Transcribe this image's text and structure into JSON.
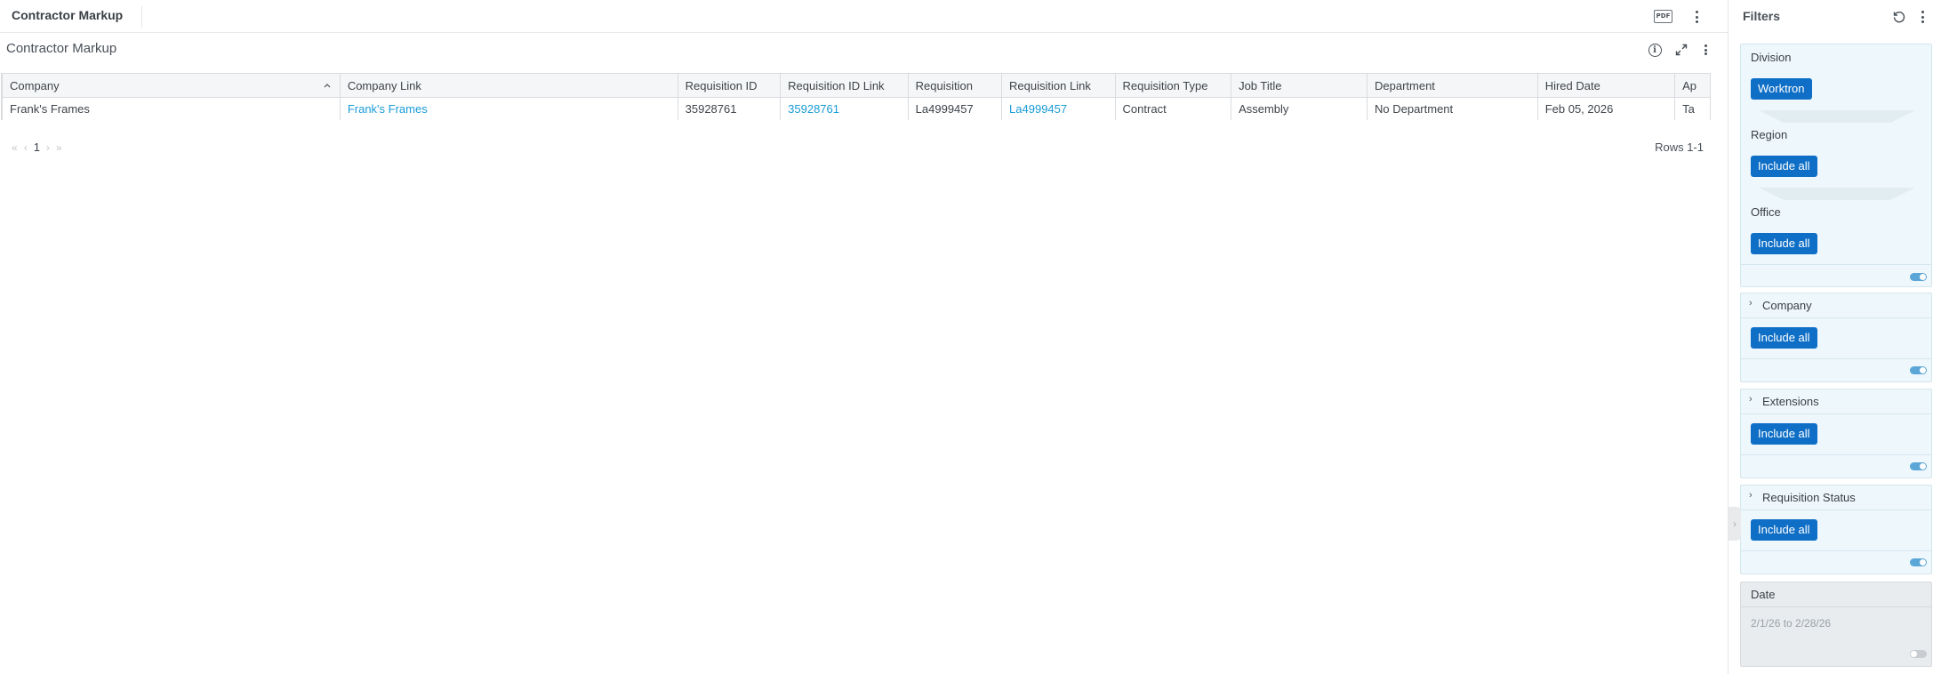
{
  "app": {
    "title": "Contractor Markup",
    "pdf_label": "PDF"
  },
  "widget": {
    "title": "Contractor Markup",
    "icons": [
      "info-icon",
      "expand-icon",
      "more-vertical-icon"
    ]
  },
  "table": {
    "columns": [
      "Company",
      "Company Link",
      "Requisition ID",
      "Requisition ID Link",
      "Requisition",
      "Requisition Link",
      "Requisition Type",
      "Job Title",
      "Department",
      "Hired Date",
      "Ap"
    ],
    "rows": [
      [
        "Frank's Frames",
        "Frank's Frames",
        "35928761",
        "35928761",
        "La4999457",
        "La4999457",
        "Contract",
        "Assembly",
        "No Department",
        "Feb 05, 2026",
        "Ta"
      ]
    ],
    "sorted_column": "Company",
    "sort_direction": "ascending"
  },
  "pagination": {
    "first": "«",
    "prev": "‹",
    "page": "1",
    "next": "›",
    "last": "»",
    "rows_label": "Rows 1-1"
  },
  "filters": {
    "title": "Filters",
    "hierarchy": {
      "division_label": "Division",
      "division_value": "Worktron",
      "region_label": "Region",
      "region_value": "Include all",
      "office_label": "Office",
      "office_value": "Include all",
      "toggle_on": true
    },
    "company": {
      "label": "Company",
      "value": "Include all",
      "toggle_on": true
    },
    "extensions": {
      "label": "Extensions",
      "value": "Include all",
      "toggle_on": true
    },
    "requisition_status": {
      "label": "Requisition Status",
      "value": "Include all",
      "toggle_on": true
    },
    "date": {
      "label": "Date",
      "value": "2/1/26 to 2/28/26",
      "toggle_on": false
    }
  },
  "colors": {
    "accent": "#0f6fc6",
    "link": "#1a9bd7",
    "filter_card_bg": "#eef8fc",
    "toggle_on": "#5aa6d6"
  }
}
